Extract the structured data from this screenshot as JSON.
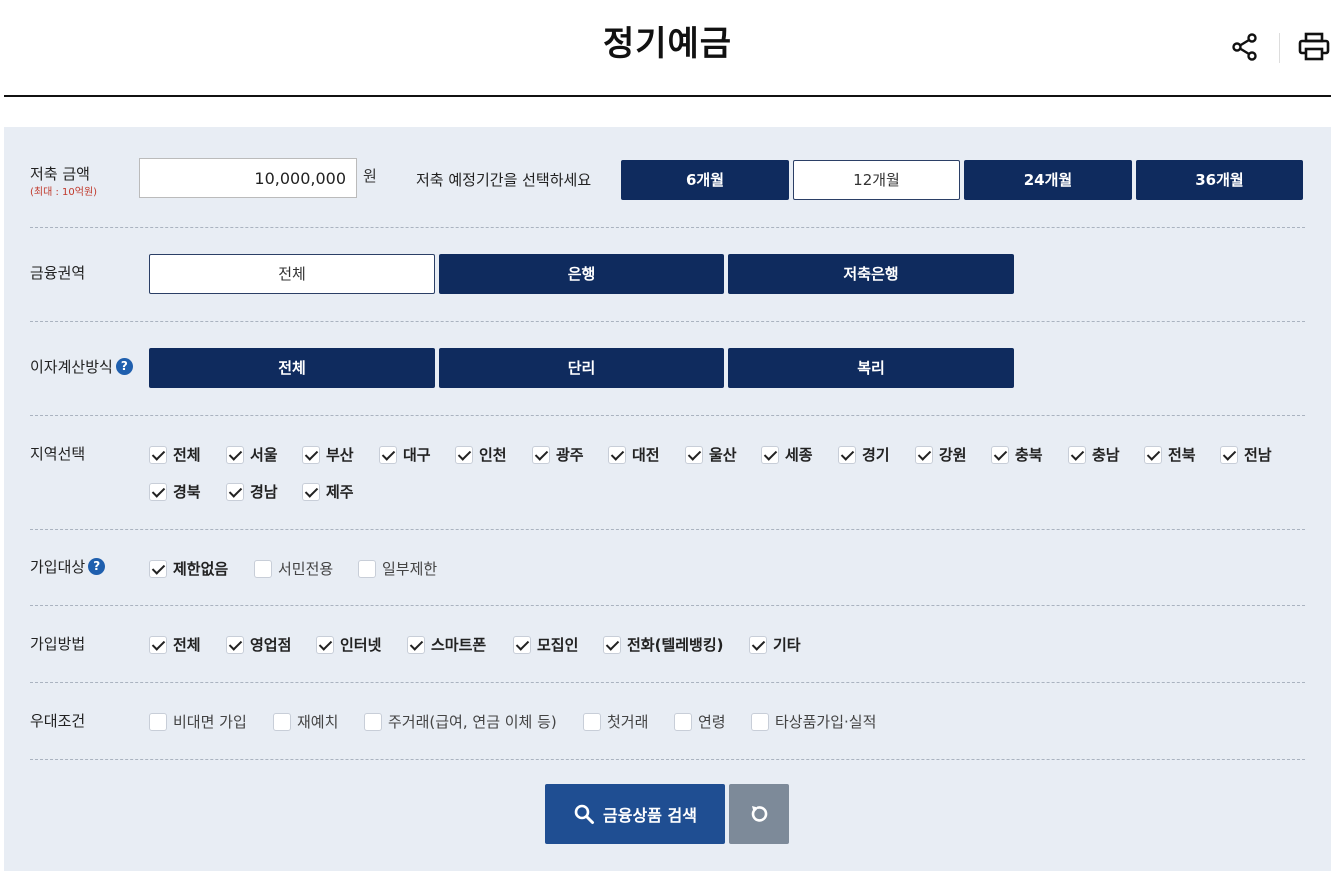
{
  "header": {
    "title": "정기예금",
    "share_icon": "share-icon",
    "print_icon": "printer-icon"
  },
  "colors": {
    "dark_button": "#0f2b5e",
    "search_button": "#1f4e92",
    "reset_button": "#7d8a99",
    "panel_bg": "#e8edf4",
    "help_icon": "#1f5fae",
    "sublabel": "#c0392b"
  },
  "amount": {
    "label": "저축 금액",
    "sublabel": "(최대 : 10억원)",
    "value": "10,000,000",
    "unit": "원"
  },
  "period": {
    "label": "저축 예정기간을 선택하세요",
    "options": [
      "6개월",
      "12개월",
      "24개월",
      "36개월"
    ],
    "selected": "12개월"
  },
  "sector": {
    "label": "금융권역",
    "options": [
      "전체",
      "은행",
      "저축은행"
    ],
    "selected": "전체"
  },
  "interest": {
    "label": "이자계산방식",
    "help": "?",
    "options": [
      "전체",
      "단리",
      "복리"
    ]
  },
  "region": {
    "label": "지역선택",
    "options": [
      "전체",
      "서울",
      "부산",
      "대구",
      "인천",
      "광주",
      "대전",
      "울산",
      "세종",
      "경기",
      "강원",
      "충북",
      "충남",
      "전북",
      "전남",
      "경북",
      "경남",
      "제주"
    ],
    "checked": true
  },
  "target": {
    "label": "가입대상",
    "help": "?",
    "options": [
      {
        "label": "제한없음",
        "checked": true
      },
      {
        "label": "서민전용",
        "checked": false
      },
      {
        "label": "일부제한",
        "checked": false
      }
    ]
  },
  "method": {
    "label": "가입방법",
    "options": [
      "전체",
      "영업점",
      "인터넷",
      "스마트폰",
      "모집인",
      "전화(텔레뱅킹)",
      "기타"
    ],
    "checked": true
  },
  "preference": {
    "label": "우대조건",
    "options": [
      "비대면 가입",
      "재예치",
      "주거래(급여, 연금 이체 등)",
      "첫거래",
      "연령",
      "타상품가입·실적"
    ],
    "checked": false
  },
  "actions": {
    "search_label": "금융상품 검색",
    "search_icon": "search-icon",
    "reset_icon": "refresh-icon"
  }
}
